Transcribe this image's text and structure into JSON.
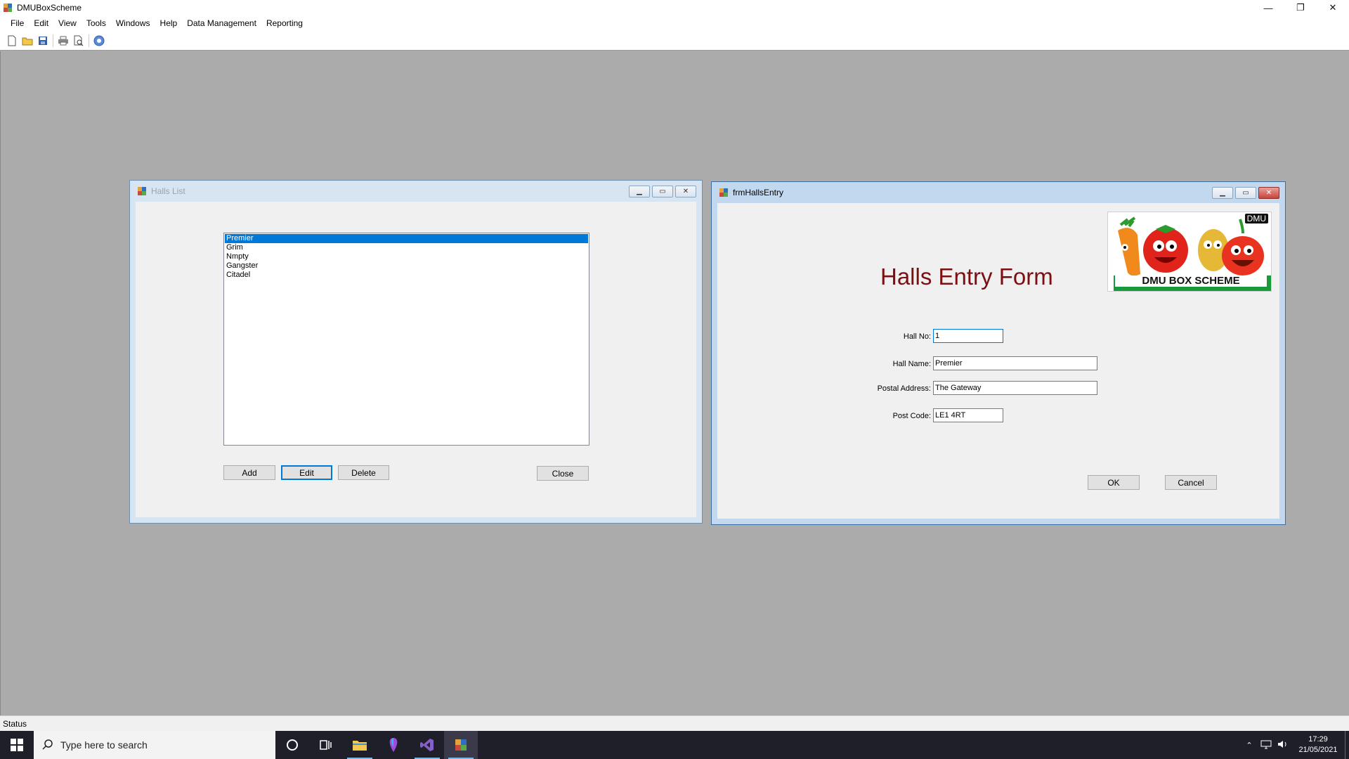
{
  "app": {
    "title": "DMUBoxScheme"
  },
  "window_controls": {
    "minimize": "—",
    "restore": "❐",
    "close": "✕"
  },
  "menu": [
    "File",
    "Edit",
    "View",
    "Tools",
    "Windows",
    "Help",
    "Data Management",
    "Reporting"
  ],
  "toolbar": {
    "icons": [
      "new-icon",
      "open-icon",
      "save-icon",
      "print-icon",
      "print-preview-icon",
      "help-icon"
    ]
  },
  "halls_list": {
    "title": "Halls List",
    "items": [
      "Premier",
      "Grim",
      "Nmpty",
      "Gangster",
      "Citadel"
    ],
    "selected_index": 0,
    "buttons": {
      "add": "Add",
      "edit": "Edit",
      "delete": "Delete",
      "close": "Close"
    }
  },
  "halls_entry": {
    "title": "frmHallsEntry",
    "heading": "Halls Entry Form",
    "logo": {
      "badge": "DMU",
      "text": "DMU BOX SCHEME"
    },
    "fields": {
      "hall_no": {
        "label": "Hall No:",
        "value": "1"
      },
      "hall_name": {
        "label": "Hall Name:",
        "value": "Premier"
      },
      "postal_address": {
        "label": "Postal Address:",
        "value": "The Gateway"
      },
      "post_code": {
        "label": "Post Code:",
        "value": "LE1 4RT"
      }
    },
    "buttons": {
      "ok": "OK",
      "cancel": "Cancel"
    }
  },
  "status": {
    "text": "Status"
  },
  "taskbar": {
    "search_placeholder": "Type here to search",
    "time": "17:29",
    "date": "21/05/2021"
  },
  "colors": {
    "accent": "#0078d7",
    "heading": "#7b0f12",
    "mdi_background": "#ababab",
    "taskbar": "#1f1f2a"
  }
}
